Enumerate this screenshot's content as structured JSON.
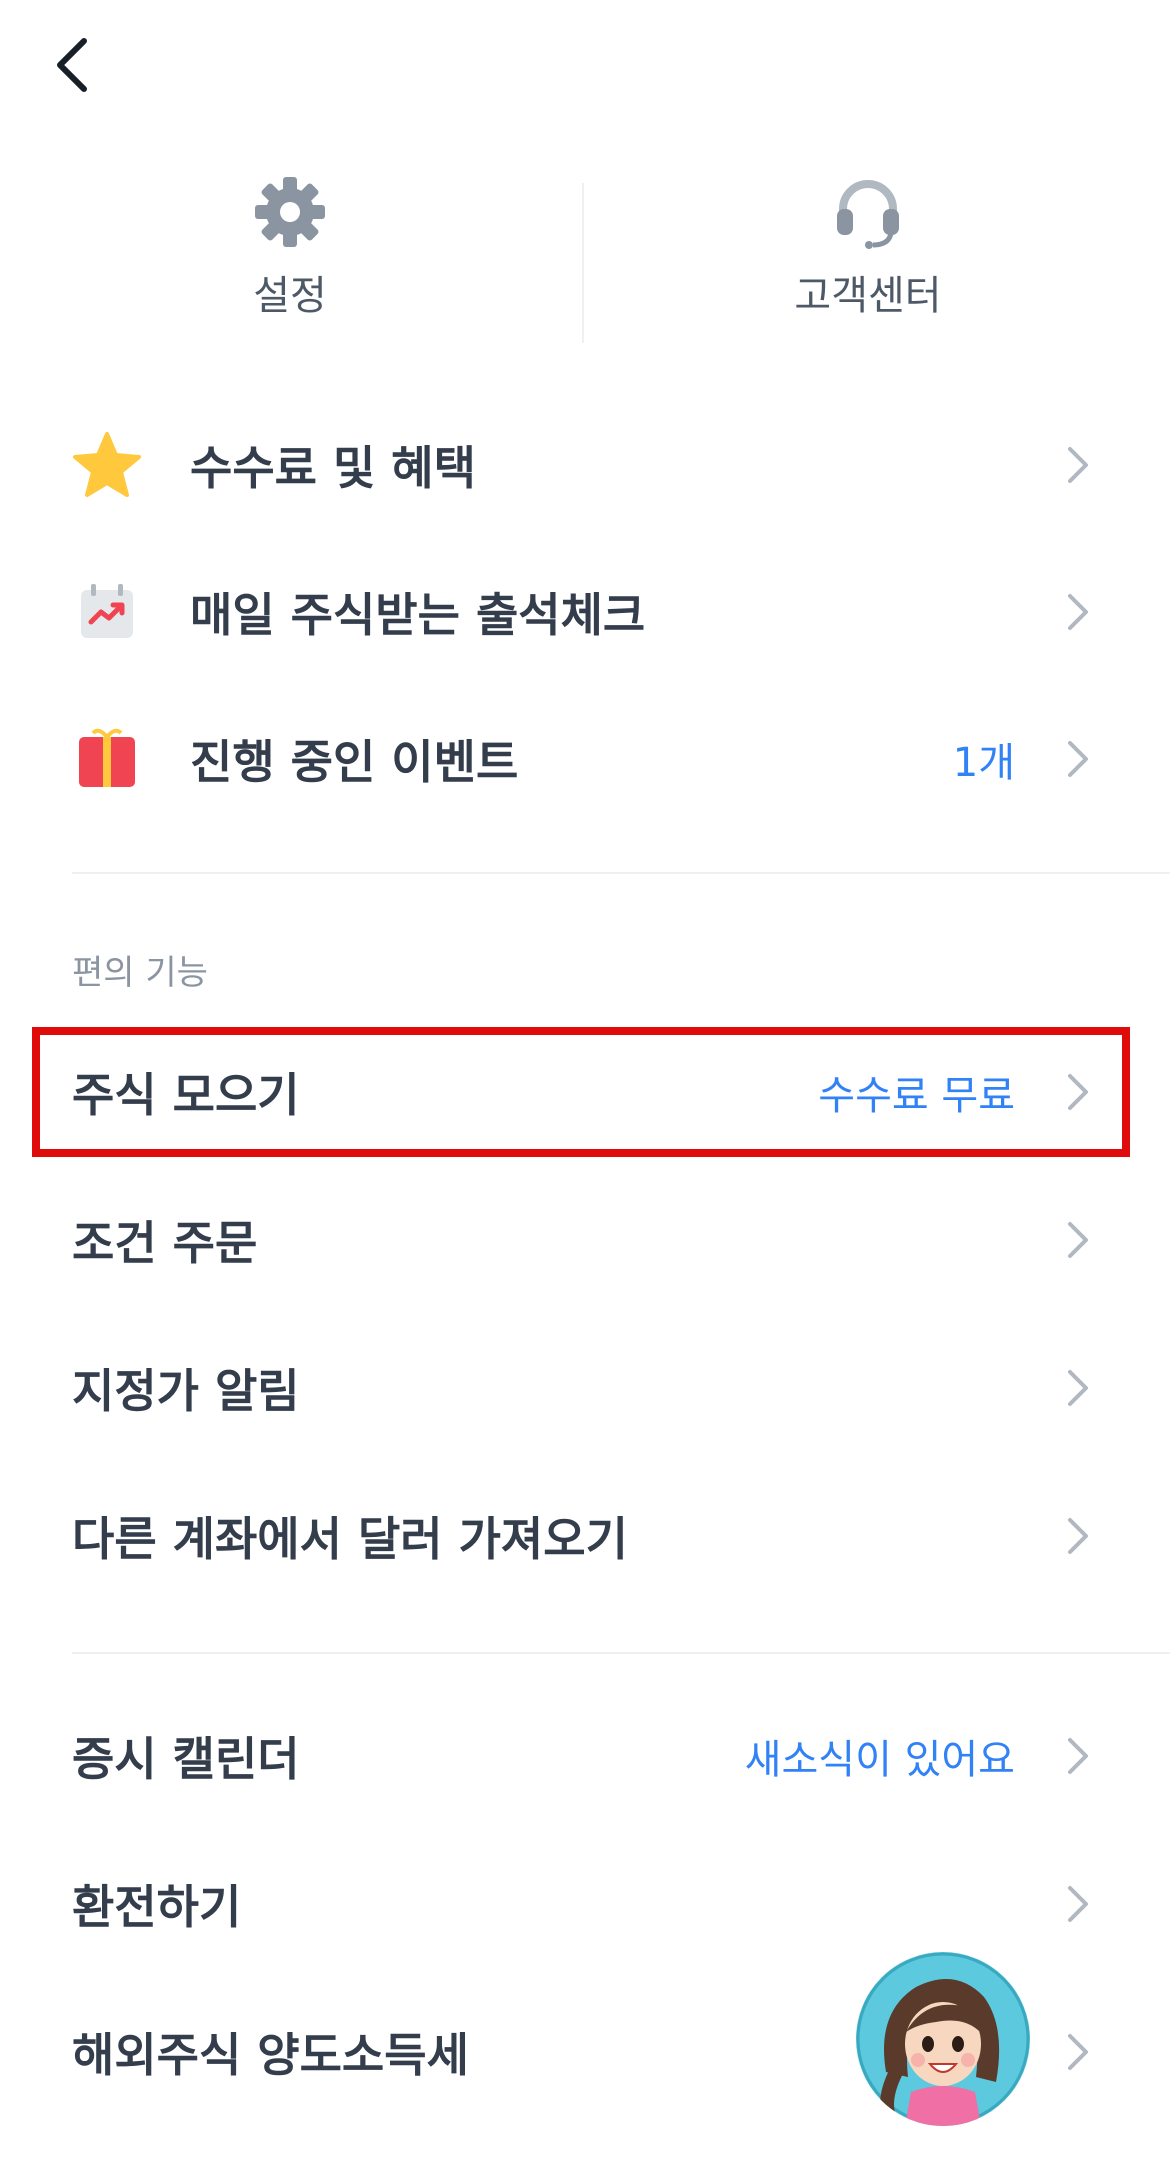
{
  "header": {
    "back_icon": "chevron-left-icon"
  },
  "shortcuts": [
    {
      "label": "설정",
      "icon": "gear-icon"
    },
    {
      "label": "고객센터",
      "icon": "headset-icon"
    }
  ],
  "benefit_items": [
    {
      "label": "수수료 및 혜택",
      "icon": "star-icon",
      "value": ""
    },
    {
      "label": "매일 주식받는 출석체크",
      "icon": "calendar-check-icon",
      "value": ""
    },
    {
      "label": "진행 중인 이벤트",
      "icon": "gift-icon",
      "value": "1개"
    }
  ],
  "convenience": {
    "section_label": "편의 기능",
    "items": [
      {
        "label": "주식 모으기",
        "value": "수수료 무료"
      },
      {
        "label": "조건 주문",
        "value": ""
      },
      {
        "label": "지정가 알림",
        "value": ""
      },
      {
        "label": "다른 계좌에서 달러 가져오기",
        "value": ""
      }
    ]
  },
  "more_items": [
    {
      "label": "증시 캘린더",
      "value": "새소식이 있어요"
    },
    {
      "label": "환전하기",
      "value": ""
    },
    {
      "label": "해외주식 양도소득세",
      "value": ""
    }
  ],
  "colors": {
    "accent": "#3182f6",
    "highlight": "#e00b0b",
    "text_primary": "#333d4b",
    "text_secondary": "#8b95a1",
    "icon_gray": "#8b95a1",
    "star": "#ffc83d",
    "gift": "#f04452"
  }
}
